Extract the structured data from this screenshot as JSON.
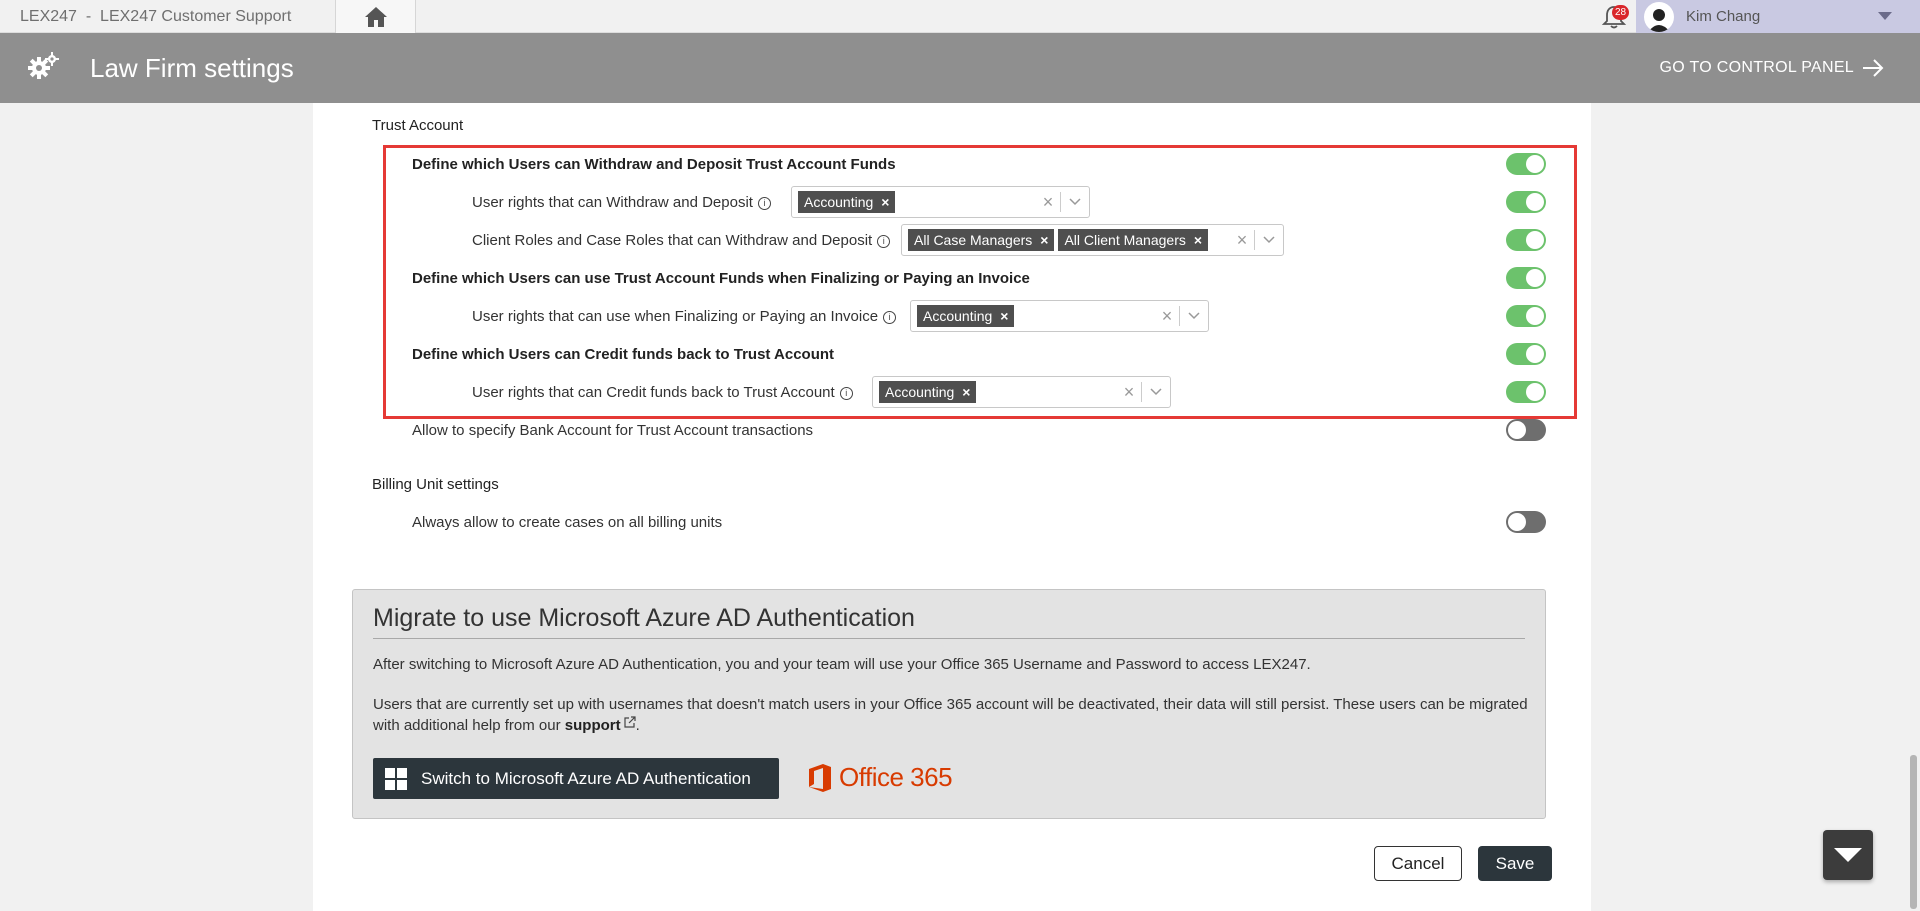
{
  "topbar": {
    "tab_title": "LEX247  -  LEX247 Customer Support",
    "notification_count": "28",
    "user_name": "Kim Chang",
    "home_icon": "home-icon",
    "bell_icon": "bell-icon"
  },
  "header": {
    "title": "Law Firm settings",
    "control_panel_link": "GO TO CONTROL PANEL",
    "icon": "gears-icon"
  },
  "trust_account": {
    "section_title": "Trust Account",
    "rows": [
      {
        "label": "Define which Users can Withdraw and Deposit Trust Account Funds",
        "bold": true,
        "toggle": "on"
      },
      {
        "label": "User rights that can Withdraw and Deposit",
        "info": "i",
        "tags": [
          "Accounting"
        ],
        "toggle": "on"
      },
      {
        "label": "Client Roles and Case Roles that can Withdraw and Deposit",
        "info": "i",
        "tags": [
          "All Case Managers",
          "All Client Managers"
        ],
        "toggle": "on"
      },
      {
        "label": "Define which Users can use Trust Account Funds when Finalizing or Paying an Invoice",
        "bold": true,
        "toggle": "on"
      },
      {
        "label": "User rights that can use when Finalizing or Paying an Invoice",
        "info": "i",
        "tags": [
          "Accounting"
        ],
        "toggle": "on"
      },
      {
        "label": "Define which Users can Credit funds back to Trust Account",
        "bold": true,
        "toggle": "on"
      },
      {
        "label": "User rights that can Credit funds back to Trust Account",
        "info": "i",
        "tags": [
          "Accounting"
        ],
        "toggle": "on"
      },
      {
        "label": "Allow to specify Bank Account for Trust Account transactions",
        "toggle": "off"
      }
    ]
  },
  "billing_unit": {
    "section_title": "Billing Unit settings",
    "rows": [
      {
        "label": "Always allow to create cases on all billing units",
        "toggle": "off"
      }
    ]
  },
  "migrate": {
    "title": "Migrate to use Microsoft Azure AD Authentication",
    "paragraph1": "After switching to Microsoft Azure AD Authentication, you and your team will use your Office 365 Username and Password to access LEX247.",
    "paragraph2_before": "Users that are currently set up with usernames that doesn't match users in your Office 365 account will be deactivated, their data will still persist. These users can be migrated with additional help from our ",
    "support_link": "support",
    "paragraph2_after": ".",
    "button_label": "Switch to Microsoft Azure AD Authentication",
    "office_label": "Office 365"
  },
  "actions": {
    "cancel": "Cancel",
    "save": "Save"
  },
  "colors": {
    "header_bg": "#8f8f8f",
    "toggle_on": "#6cc26c",
    "toggle_off": "#6e6e6e",
    "highlight": "#e53935",
    "dark_button": "#2c363c",
    "office_red": "#d83b01"
  }
}
